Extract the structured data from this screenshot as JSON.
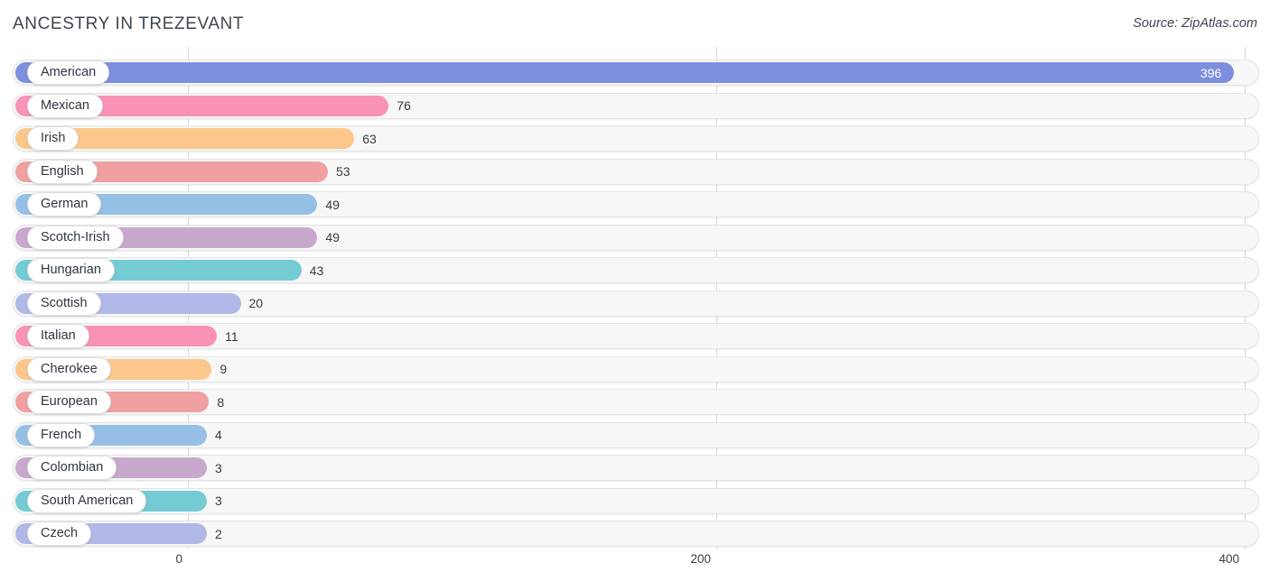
{
  "header": {
    "title": "ANCESTRY IN TREZEVANT",
    "source": "Source: ZipAtlas.com"
  },
  "axis": {
    "ticks": [
      "0",
      "200",
      "400"
    ]
  },
  "chart_data": {
    "type": "bar",
    "orientation": "horizontal",
    "title": "ANCESTRY IN TREZEVANT",
    "xlabel": "",
    "ylabel": "",
    "xlim": [
      0,
      400
    ],
    "gridlines": [
      0,
      200,
      400
    ],
    "grid": true,
    "legend": "none",
    "source": "Source: ZipAtlas.com",
    "categories": [
      "American",
      "Mexican",
      "Irish",
      "English",
      "German",
      "Scotch-Irish",
      "Hungarian",
      "Scottish",
      "Italian",
      "Cherokee",
      "European",
      "French",
      "Colombian",
      "South American",
      "Czech"
    ],
    "values": [
      396,
      76,
      63,
      53,
      49,
      49,
      43,
      20,
      11,
      9,
      8,
      4,
      3,
      3,
      2
    ],
    "colors": [
      "#7e8fdd",
      "#f892b6",
      "#fbc78b",
      "#f0a0a0",
      "#96bfe6",
      "#c9a8ce",
      "#74cbd4",
      "#b0b8e8",
      "#f892b6",
      "#fbc78b",
      "#f0a0a0",
      "#96bfe6",
      "#c9a8ce",
      "#74cbd4",
      "#b0b8e8"
    ],
    "bars": [
      {
        "label": "American",
        "value": 396,
        "value_text": "396",
        "color": "#7e8fdd",
        "label_inside": true
      },
      {
        "label": "Mexican",
        "value": 76,
        "value_text": "76",
        "color": "#f892b6",
        "label_inside": false
      },
      {
        "label": "Irish",
        "value": 63,
        "value_text": "63",
        "color": "#fbc78b",
        "label_inside": false
      },
      {
        "label": "English",
        "value": 53,
        "value_text": "53",
        "color": "#f0a0a0",
        "label_inside": false
      },
      {
        "label": "German",
        "value": 49,
        "value_text": "49",
        "color": "#96bfe6",
        "label_inside": false
      },
      {
        "label": "Scotch-Irish",
        "value": 49,
        "value_text": "49",
        "color": "#c9a8ce",
        "label_inside": false
      },
      {
        "label": "Hungarian",
        "value": 43,
        "value_text": "43",
        "color": "#74cbd4",
        "label_inside": false
      },
      {
        "label": "Scottish",
        "value": 20,
        "value_text": "20",
        "color": "#b0b8e8",
        "label_inside": false
      },
      {
        "label": "Italian",
        "value": 11,
        "value_text": "11",
        "color": "#f892b6",
        "label_inside": false
      },
      {
        "label": "Cherokee",
        "value": 9,
        "value_text": "9",
        "color": "#fbc78b",
        "label_inside": false
      },
      {
        "label": "European",
        "value": 8,
        "value_text": "8",
        "color": "#f0a0a0",
        "label_inside": false
      },
      {
        "label": "French",
        "value": 4,
        "value_text": "4",
        "color": "#96bfe6",
        "label_inside": false
      },
      {
        "label": "Colombian",
        "value": 3,
        "value_text": "3",
        "color": "#c9a8ce",
        "label_inside": false
      },
      {
        "label": "South American",
        "value": 3,
        "value_text": "3",
        "color": "#74cbd4",
        "label_inside": false
      },
      {
        "label": "Czech",
        "value": 2,
        "value_text": "2",
        "color": "#b0b8e8",
        "label_inside": false
      }
    ]
  }
}
